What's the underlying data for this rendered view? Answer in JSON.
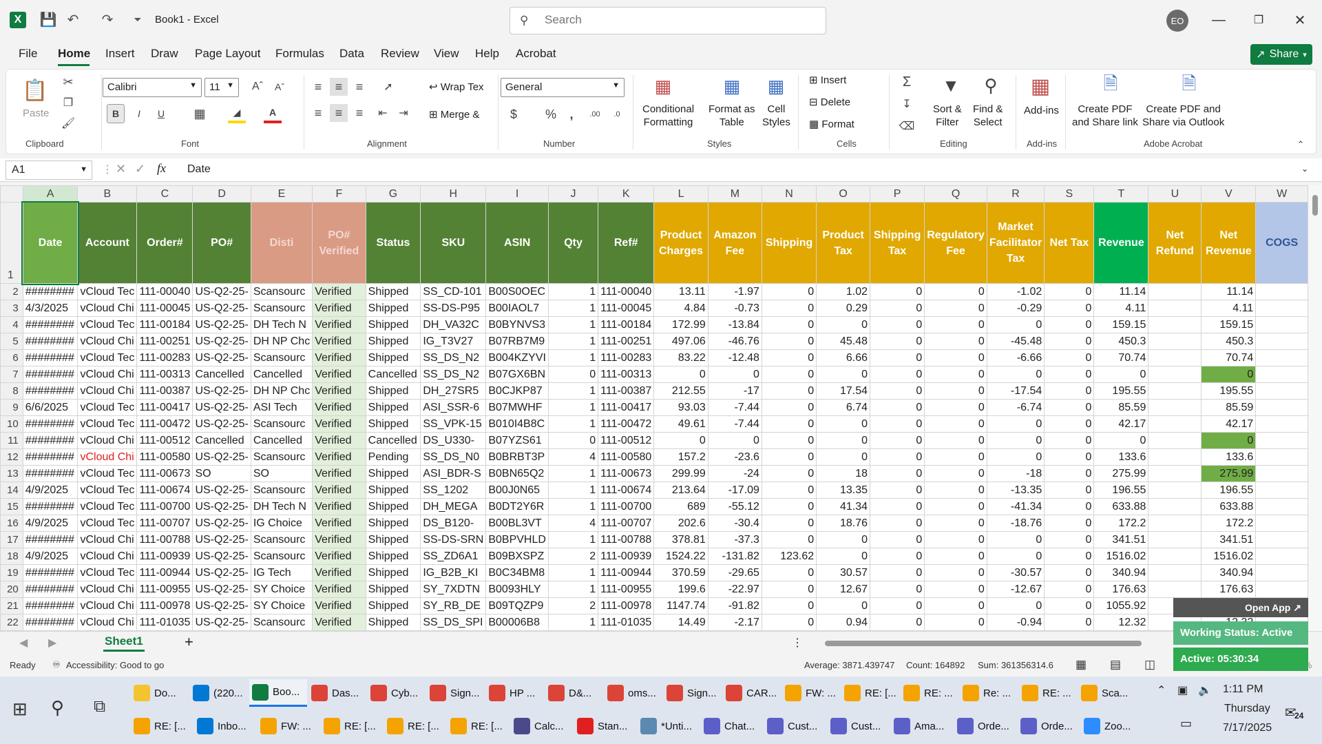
{
  "title": {
    "doc": "Book1  -  Excel",
    "search_placeholder": "Search",
    "avatar": "EO"
  },
  "menu": [
    "File",
    "Home",
    "Insert",
    "Draw",
    "Page Layout",
    "Formulas",
    "Data",
    "Review",
    "View",
    "Help",
    "Acrobat"
  ],
  "share": "Share",
  "ribbon": {
    "clipboard": {
      "paste": "Paste",
      "label": "Clipboard"
    },
    "font": {
      "name": "Calibri",
      "size": "11",
      "label": "Font"
    },
    "alignment": {
      "wrap": "Wrap Tex",
      "merge": "Merge &",
      "label": "Alignment"
    },
    "number": {
      "format": "General",
      "label": "Number"
    },
    "styles": {
      "cond1": "Conditional",
      "cond2": "Formatting",
      "fmt1": "Format as",
      "fmt2": "Table",
      "cell1": "Cell",
      "cell2": "Styles",
      "label": "Styles"
    },
    "cells": {
      "insert": "Insert",
      "delete": "Delete",
      "format": "Format",
      "label": "Cells"
    },
    "editing": {
      "sort1": "Sort &",
      "sort2": "Filter",
      "find1": "Find &",
      "find2": "Select",
      "label": "Editing"
    },
    "addins": {
      "btn": "Add-ins",
      "label": "Add-ins"
    },
    "acrobat": {
      "pdf1a": "Create PDF",
      "pdf1b": "and Share link",
      "pdf2a": "Create PDF and",
      "pdf2b": "Share via Outlook",
      "label": "Adobe Acrobat"
    }
  },
  "formula": {
    "cell": "A1",
    "value": "Date"
  },
  "columns": [
    "A",
    "B",
    "C",
    "D",
    "E",
    "F",
    "G",
    "H",
    "I",
    "J",
    "K",
    "L",
    "M",
    "N",
    "O",
    "P",
    "Q",
    "R",
    "S",
    "T",
    "U",
    "V",
    "W"
  ],
  "headers": [
    "Date",
    "Account",
    "Order#",
    "PO#",
    "Disti",
    "PO# Verified",
    "Status",
    "SKU",
    "ASIN",
    "Qty",
    "Ref#",
    "Product Charges",
    "Amazon Fee",
    "Shipping",
    "Product Tax",
    "Shipping Tax",
    "Regulatory Fee",
    "Market Facilitator Tax",
    "Net Tax",
    "Revenue",
    "Net Refund",
    "Net Revenue",
    "COGS"
  ],
  "header_colors": [
    "#70ad47",
    "#548235",
    "#548235",
    "#548235",
    "#d99b84",
    "#d99b84",
    "#548235",
    "#548235",
    "#548235",
    "#548235",
    "#548235",
    "#e0a800",
    "#e0a800",
    "#e0a800",
    "#e0a800",
    "#e0a800",
    "#e0a800",
    "#e0a800",
    "#e0a800",
    "#00b050",
    "#e0a800",
    "#e0a800",
    "#b4c6e7"
  ],
  "rows": [
    [
      "########",
      "vCloud Tec",
      "111-00040",
      "US-Q2-25-",
      "Scansourc",
      "Verified",
      "Shipped",
      "SS_CD-101",
      "B00S0OEC",
      "1",
      "111-00040",
      "13.11",
      "-1.97",
      "0",
      "1.02",
      "0",
      "0",
      "-1.02",
      "0",
      "11.14",
      "",
      "11.14",
      ""
    ],
    [
      "4/3/2025",
      "vCloud Chi",
      "111-00045",
      "US-Q2-25-",
      "Scansourc",
      "Verified",
      "Shipped",
      "SS-DS-P95",
      "B00IAOL7",
      "1",
      "111-00045",
      "4.84",
      "-0.73",
      "0",
      "0.29",
      "0",
      "0",
      "-0.29",
      "0",
      "4.11",
      "",
      "4.11",
      ""
    ],
    [
      "########",
      "vCloud Tec",
      "111-00184",
      "US-Q2-25-",
      "DH Tech N",
      "Verified",
      "Shipped",
      "DH_VA32C",
      "B0BYNVS3",
      "1",
      "111-00184",
      "172.99",
      "-13.84",
      "0",
      "0",
      "0",
      "0",
      "0",
      "0",
      "159.15",
      "",
      "159.15",
      ""
    ],
    [
      "########",
      "vCloud Chi",
      "111-00251",
      "US-Q2-25-",
      "DH NP Chc",
      "Verified",
      "Shipped",
      "IG_T3V27",
      "B07RB7M9",
      "1",
      "111-00251",
      "497.06",
      "-46.76",
      "0",
      "45.48",
      "0",
      "0",
      "-45.48",
      "0",
      "450.3",
      "",
      "450.3",
      ""
    ],
    [
      "########",
      "vCloud Tec",
      "111-00283",
      "US-Q2-25-",
      "Scansourc",
      "Verified",
      "Shipped",
      "SS_DS_N2",
      "B004KZYVI",
      "1",
      "111-00283",
      "83.22",
      "-12.48",
      "0",
      "6.66",
      "0",
      "0",
      "-6.66",
      "0",
      "70.74",
      "",
      "70.74",
      ""
    ],
    [
      "########",
      "vCloud Chi",
      "111-00313",
      "Cancelled",
      "Cancelled",
      "Verified",
      "Cancelled",
      "SS_DS_N2",
      "B07GX6BN",
      "0",
      "111-00313",
      "0",
      "0",
      "0",
      "0",
      "0",
      "0",
      "0",
      "0",
      "0",
      "",
      "0",
      ""
    ],
    [
      "########",
      "vCloud Chi",
      "111-00387",
      "US-Q2-25-",
      "DH NP Chc",
      "Verified",
      "Shipped",
      "DH_27SR5",
      "B0CJKP87",
      "1",
      "111-00387",
      "212.55",
      "-17",
      "0",
      "17.54",
      "0",
      "0",
      "-17.54",
      "0",
      "195.55",
      "",
      "195.55",
      ""
    ],
    [
      "6/6/2025",
      "vCloud Tec",
      "111-00417",
      "US-Q2-25-",
      "ASI Tech",
      "Verified",
      "Shipped",
      "ASI_SSR-6",
      "B07MWHF",
      "1",
      "111-00417",
      "93.03",
      "-7.44",
      "0",
      "6.74",
      "0",
      "0",
      "-6.74",
      "0",
      "85.59",
      "",
      "85.59",
      ""
    ],
    [
      "########",
      "vCloud Tec",
      "111-00472",
      "US-Q2-25-",
      "Scansourc",
      "Verified",
      "Shipped",
      "SS_VPK-15",
      "B010I4B8C",
      "1",
      "111-00472",
      "49.61",
      "-7.44",
      "0",
      "0",
      "0",
      "0",
      "0",
      "0",
      "42.17",
      "",
      "42.17",
      ""
    ],
    [
      "########",
      "vCloud Chi",
      "111-00512",
      "Cancelled",
      "Cancelled",
      "Verified",
      "Cancelled",
      "DS_U330-",
      "B07YZS61",
      "0",
      "111-00512",
      "0",
      "0",
      "0",
      "0",
      "0",
      "0",
      "0",
      "0",
      "0",
      "",
      "0",
      ""
    ],
    [
      "########",
      "vCloud Chi",
      "111-00580",
      "US-Q2-25-",
      "Scansourc",
      "Verified",
      "Pending",
      "SS_DS_N0",
      "B0BRBT3P",
      "4",
      "111-00580",
      "157.2",
      "-23.6",
      "0",
      "0",
      "0",
      "0",
      "0",
      "0",
      "133.6",
      "",
      "133.6",
      ""
    ],
    [
      "########",
      "vCloud Tec",
      "111-00673",
      "SO",
      "SO",
      "Verified",
      "Shipped",
      "ASI_BDR-S",
      "B0BN65Q2",
      "1",
      "111-00673",
      "299.99",
      "-24",
      "0",
      "18",
      "0",
      "0",
      "-18",
      "0",
      "275.99",
      "",
      "275.99",
      ""
    ],
    [
      "4/9/2025",
      "vCloud Tec",
      "111-00674",
      "US-Q2-25-",
      "Scansourc",
      "Verified",
      "Shipped",
      "SS_1202",
      "B00J0N65",
      "1",
      "111-00674",
      "213.64",
      "-17.09",
      "0",
      "13.35",
      "0",
      "0",
      "-13.35",
      "0",
      "196.55",
      "",
      "196.55",
      ""
    ],
    [
      "########",
      "vCloud Tec",
      "111-00700",
      "US-Q2-25-",
      "DH Tech N",
      "Verified",
      "Shipped",
      "DH_MEGA",
      "B0DT2Y6R",
      "1",
      "111-00700",
      "689",
      "-55.12",
      "0",
      "41.34",
      "0",
      "0",
      "-41.34",
      "0",
      "633.88",
      "",
      "633.88",
      ""
    ],
    [
      "4/9/2025",
      "vCloud Tec",
      "111-00707",
      "US-Q2-25-",
      "IG Choice",
      "Verified",
      "Shipped",
      "DS_B120-",
      "B00BL3VT",
      "4",
      "111-00707",
      "202.6",
      "-30.4",
      "0",
      "18.76",
      "0",
      "0",
      "-18.76",
      "0",
      "172.2",
      "",
      "172.2",
      ""
    ],
    [
      "########",
      "vCloud Chi",
      "111-00788",
      "US-Q2-25-",
      "Scansourc",
      "Verified",
      "Shipped",
      "SS-DS-SRN",
      "B0BPVHLD",
      "1",
      "111-00788",
      "378.81",
      "-37.3",
      "0",
      "0",
      "0",
      "0",
      "0",
      "0",
      "341.51",
      "",
      "341.51",
      ""
    ],
    [
      "4/9/2025",
      "vCloud Chi",
      "111-00939",
      "US-Q2-25-",
      "Scansourc",
      "Verified",
      "Shipped",
      "SS_ZD6A1",
      "B09BXSPZ",
      "2",
      "111-00939",
      "1524.22",
      "-131.82",
      "123.62",
      "0",
      "0",
      "0",
      "0",
      "0",
      "1516.02",
      "",
      "1516.02",
      ""
    ],
    [
      "########",
      "vCloud Tec",
      "111-00944",
      "US-Q2-25-",
      "IG Tech",
      "Verified",
      "Shipped",
      "IG_B2B_KI",
      "B0C34BM8",
      "1",
      "111-00944",
      "370.59",
      "-29.65",
      "0",
      "30.57",
      "0",
      "0",
      "-30.57",
      "0",
      "340.94",
      "",
      "340.94",
      ""
    ],
    [
      "########",
      "vCloud Chi",
      "111-00955",
      "US-Q2-25-",
      "SY Choice",
      "Verified",
      "Shipped",
      "SY_7XDTN",
      "B0093HLY",
      "1",
      "111-00955",
      "199.6",
      "-22.97",
      "0",
      "12.67",
      "0",
      "0",
      "-12.67",
      "0",
      "176.63",
      "",
      "176.63",
      ""
    ],
    [
      "########",
      "vCloud Chi",
      "111-00978",
      "US-Q2-25-",
      "SY Choice",
      "Verified",
      "Shipped",
      "SY_RB_DE",
      "B09TQZP9",
      "2",
      "111-00978",
      "1147.74",
      "-91.82",
      "0",
      "0",
      "0",
      "0",
      "0",
      "0",
      "1055.92",
      "",
      "1055.92",
      ""
    ],
    [
      "########",
      "vCloud Chi",
      "111-01035",
      "US-Q2-25-",
      "Scansourc",
      "Verified",
      "Shipped",
      "SS_DS_SPI",
      "B00006B8",
      "1",
      "111-01035",
      "14.49",
      "-2.17",
      "0",
      "0.94",
      "0",
      "0",
      "-0.94",
      "0",
      "12.32",
      "",
      "12.32",
      ""
    ]
  ],
  "sheet_tab": "Sheet1",
  "status": {
    "ready": "Ready",
    "accessibility": "Accessibility: Good to go",
    "average": "Average: 3871.439747",
    "count": "Count: 164892",
    "sum": "Sum: 361356314.6",
    "zoom": "100%"
  },
  "widget": {
    "open_app": "Open App",
    "working": "Working Status: Active",
    "active": "Active: 05:30:34"
  },
  "taskbar": {
    "row1": [
      "Do...",
      "(220...",
      "Boo...",
      "Das...",
      "Cyb...",
      "Sign...",
      "HP ...",
      "D&...",
      "oms...",
      "Sign...",
      "CAR...",
      "FW: ...",
      "RE: [...",
      "RE: ...",
      "Re: ...",
      "RE: ...",
      "Sca..."
    ],
    "row2": [
      "RE: [...",
      "Inbo...",
      "FW: ...",
      "RE: [...",
      "RE: [...",
      "RE: [...",
      "Calc...",
      "Stan...",
      "*Unti...",
      "Chat...",
      "Cust...",
      "Cust...",
      "Ama...",
      "Orde...",
      "Orde...",
      "Zoo..."
    ],
    "time": "1:11 PM",
    "day": "Thursday",
    "date": "7/17/2025",
    "notif": "24"
  }
}
